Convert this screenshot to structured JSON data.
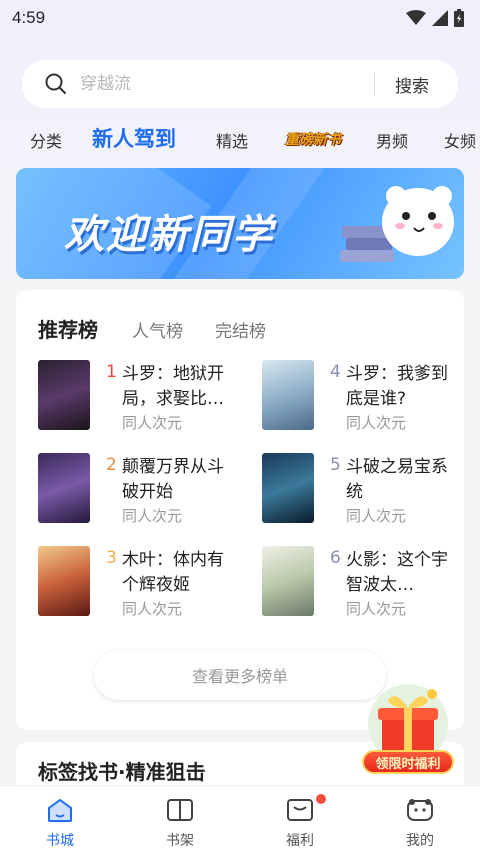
{
  "status_bar": {
    "time": "4:59"
  },
  "search": {
    "placeholder": "穿越流",
    "button_label": "搜索"
  },
  "tabs": [
    {
      "label": "分类"
    },
    {
      "label": "新人驾到",
      "active": true
    },
    {
      "label": "精选"
    },
    {
      "label": "重磅新书",
      "style": "promo-logo"
    },
    {
      "label": "男频"
    },
    {
      "label": "女频"
    }
  ],
  "banner": {
    "title": "欢迎新同学"
  },
  "ranking": {
    "tabs": [
      "推荐榜",
      "人气榜",
      "完结榜"
    ],
    "items": [
      {
        "rank": "1",
        "title": "斗罗：地狱开局，求娶比…",
        "genre": "同人次元",
        "rank_color": "#f0443a"
      },
      {
        "rank": "2",
        "title": "颠覆万界从斗破开始",
        "genre": "同人次元",
        "rank_color": "#f08a3a"
      },
      {
        "rank": "3",
        "title": "木叶：体内有个辉夜姬",
        "genre": "同人次元",
        "rank_color": "#f0b04a"
      },
      {
        "rank": "4",
        "title": "斗罗：我爹到底是谁?",
        "genre": "同人次元",
        "rank_color": "#8a8fb0"
      },
      {
        "rank": "5",
        "title": "斗破之易宝系统",
        "genre": "同人次元",
        "rank_color": "#8a8fb0"
      },
      {
        "rank": "6",
        "title": "火影：这个宇智波太…",
        "genre": "同人次元",
        "rank_color": "#8a8fb0"
      }
    ],
    "more_label": "查看更多榜单"
  },
  "section2": {
    "title": "标签找书·精准狙击"
  },
  "gift": {
    "label": "领限时福利"
  },
  "bottom_nav": [
    {
      "label": "书城",
      "icon": "home-icon",
      "active": true
    },
    {
      "label": "书架",
      "icon": "bookshelf-icon"
    },
    {
      "label": "福利",
      "icon": "gift-icon",
      "badge": true
    },
    {
      "label": "我的",
      "icon": "profile-icon"
    }
  ]
}
